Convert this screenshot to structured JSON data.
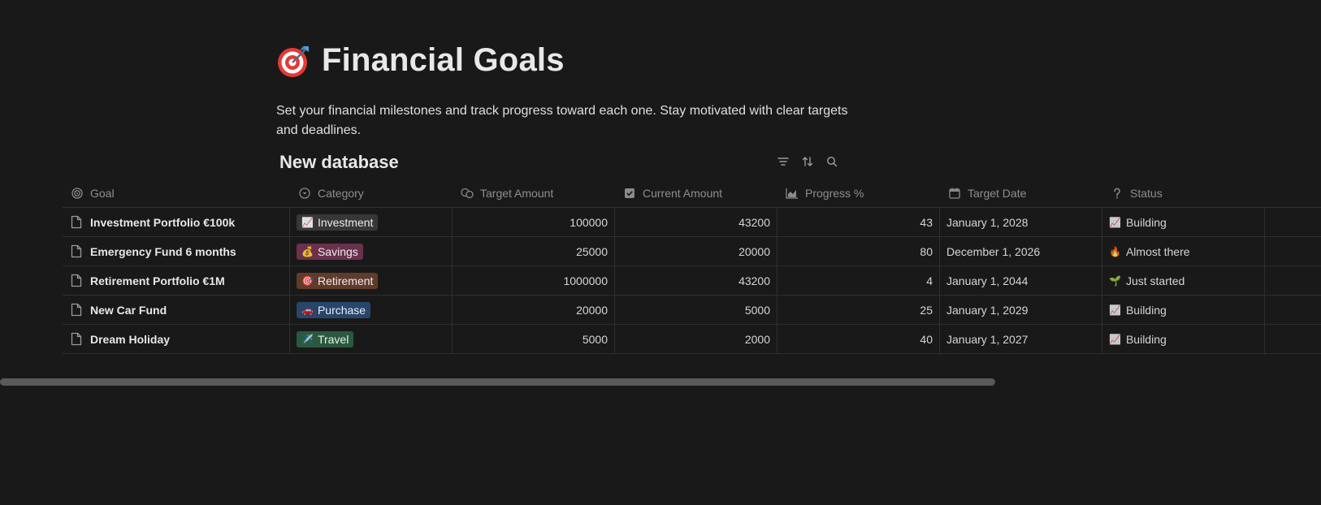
{
  "page": {
    "icon": "direct-hit-target-icon",
    "title": "Financial Goals",
    "description": "Set your financial milestones and track progress toward each one. Stay motivated with clear targets and deadlines."
  },
  "database": {
    "title": "New database",
    "tools": [
      "filter-icon",
      "sort-icon",
      "search-icon"
    ]
  },
  "columns": [
    {
      "label": "Goal",
      "icon": "target-icon"
    },
    {
      "label": "Category",
      "icon": "select-icon"
    },
    {
      "label": "Target Amount",
      "icon": "coins-icon"
    },
    {
      "label": "Current Amount",
      "icon": "checkbox-icon"
    },
    {
      "label": "Progress %",
      "icon": "area-chart-icon"
    },
    {
      "label": "Target Date",
      "icon": "calendar-icon"
    },
    {
      "label": "Status",
      "icon": "question-icon"
    }
  ],
  "rows": [
    {
      "goal": "Investment Portfolio €100k",
      "category": "Investment",
      "category_emoji": "📈",
      "category_color": "#373737",
      "target": "100000",
      "current": "43200",
      "progress": "43",
      "date": "January 1, 2028",
      "status": "Building",
      "status_emoji": "📈"
    },
    {
      "goal": "Emergency Fund 6 months",
      "category": "Savings",
      "category_emoji": "💰",
      "category_color": "#69314c",
      "target": "25000",
      "current": "20000",
      "progress": "80",
      "date": "December 1, 2026",
      "status": "Almost there",
      "status_emoji": "🔥"
    },
    {
      "goal": "Retirement Portfolio €1M",
      "category": "Retirement",
      "category_emoji": "🎯",
      "category_color": "#603b2c",
      "target": "1000000",
      "current": "43200",
      "progress": "4",
      "date": "January 1, 2044",
      "status": "Just started",
      "status_emoji": "🌱"
    },
    {
      "goal": "New Car Fund",
      "category": "Purchase",
      "category_emoji": "🚗",
      "category_color": "#28456c",
      "target": "20000",
      "current": "5000",
      "progress": "25",
      "date": "January 1, 2029",
      "status": "Building",
      "status_emoji": "📈"
    },
    {
      "goal": "Dream Holiday",
      "category": "Travel",
      "category_emoji": "✈️",
      "category_color": "#2b593f",
      "target": "5000",
      "current": "2000",
      "progress": "40",
      "date": "January 1, 2027",
      "status": "Building",
      "status_emoji": "📈"
    }
  ],
  "colors": {
    "background": "#191919",
    "border": "#2f2f2f",
    "scrollbar": "#5a5a5a"
  }
}
